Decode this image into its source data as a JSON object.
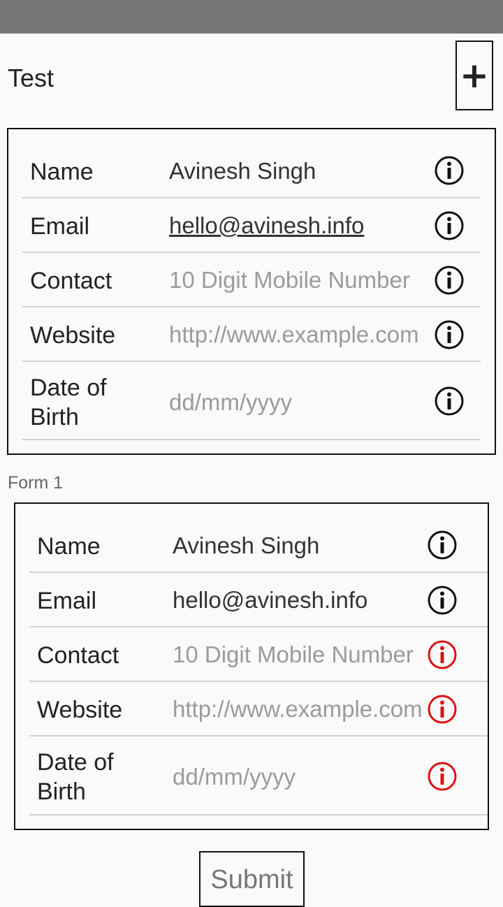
{
  "app": {
    "title": "Test",
    "add_label": "+"
  },
  "form_a": {
    "rows": [
      {
        "label": "Name",
        "value": "Avinesh Singh",
        "state": "filled"
      },
      {
        "label": "Email",
        "value": "hello@avinesh.info",
        "state": "link"
      },
      {
        "label": "Contact",
        "value": "10 Digit Mobile Number",
        "state": "placeholder"
      },
      {
        "label": "Website",
        "value": "http://www.example.com",
        "state": "placeholder"
      },
      {
        "label": "Date of\nBirth",
        "value": "dd/mm/yyyy",
        "state": "placeholder"
      }
    ]
  },
  "form_caption": "Form 1",
  "form_b": {
    "rows": [
      {
        "label": "Name",
        "value": "Avinesh Singh",
        "state": "filled",
        "info": "normal"
      },
      {
        "label": "Email",
        "value": "hello@avinesh.info",
        "state": "filled",
        "info": "normal"
      },
      {
        "label": "Contact",
        "value": "10 Digit Mobile Number",
        "state": "placeholder",
        "info": "error"
      },
      {
        "label": "Website",
        "value": "http://www.example.com",
        "state": "placeholder",
        "info": "error"
      },
      {
        "label": "Date of\nBirth",
        "value": "dd/mm/yyyy",
        "state": "placeholder",
        "info": "error"
      }
    ]
  },
  "submit_label": "Submit",
  "colors": {
    "status_bar": "#757575",
    "info_normal": "#111111",
    "info_error": "#dd1111",
    "divider": "#d2d2d2"
  },
  "icons": {
    "info": "info-circle-icon",
    "add": "plus-icon"
  }
}
